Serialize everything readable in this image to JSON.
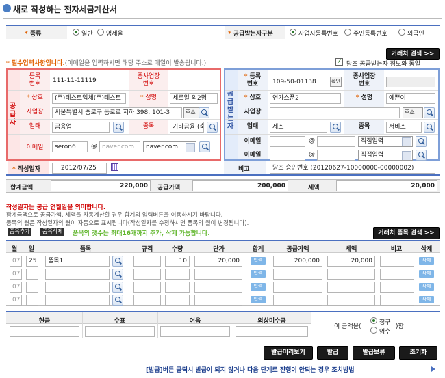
{
  "page": {
    "title": "새로 작성하는 전자세금계산서"
  },
  "type_row": {
    "kind_label": "종류",
    "kind_options": [
      "일반",
      "영세율"
    ],
    "kind_selected": 0,
    "recv_label": "공급받는자구분",
    "recv_options": [
      "사업자등록번호",
      "주민등록번호",
      "외국인"
    ],
    "recv_selected": 0
  },
  "buttons": {
    "partner_search": "거래처 검색 >>",
    "item_search": "거래처 품목 검색 >>",
    "add_item": "품목추가",
    "del_item": "품목삭제",
    "preview": "발급미리보기",
    "issue": "발급",
    "hold": "발급보류",
    "reset": "초기화",
    "confirm": "확인",
    "address": "주소",
    "input": "입력",
    "delete": "삭제"
  },
  "required_note": {
    "title": "* 필수입력사항입니다.",
    "text": "(이메일을 입력하시면 해당 주소로 메일이 발송됩니다.)"
  },
  "same_check": {
    "label": "당초 공급받는자 정보와 동일",
    "checked": true
  },
  "supplier": {
    "side_label": "공급자",
    "reg_label": "등록\n번호",
    "reg_value": "111-11-11119",
    "branch_label": "종사업장\n번호",
    "branch_value": "",
    "name_label": "상호",
    "name_value": "(주)테스트업체(주)테스트",
    "rep_label": "성명",
    "rep_value": "세로일 외2명",
    "addr_label": "사업장",
    "addr_value": "서울특별시 중로구 동로로 지하 398, 101-3",
    "biz_label": "업태",
    "biz_value": "금융업",
    "item_label": "종목",
    "item_value": "기타금융 (축협)",
    "email_label": "이메일",
    "email_id": "seron6",
    "email_domain_placeholder": "naver.com",
    "email_domain_select": "naver.com"
  },
  "buyer": {
    "side_label": "공급받는자",
    "reg_label": "등록\n번호",
    "reg_value": "109-50-01138",
    "branch_label": "종사업장\n번호",
    "branch_value": "",
    "name_label": "상호",
    "name_value": "연가스푼2",
    "rep_label": "성명",
    "rep_value": "예쁜이",
    "addr_label": "사업장",
    "addr_value": "",
    "biz_label": "업태",
    "biz_value": "제조",
    "item_label": "종목",
    "item_value": "서비스",
    "email_label": "이메일",
    "email_select": "직접입력"
  },
  "write_date": {
    "label": "작성일자",
    "value": "2012/07/25"
  },
  "remark": {
    "label": "비고",
    "value": "당초 승인번호 (20120627-10000000-00000002)"
  },
  "totals": {
    "sum_label": "합계금액",
    "sum_value": "220,000",
    "supply_label": "공급가액",
    "supply_value": "200,000",
    "tax_label": "세액",
    "tax_value": "20,000"
  },
  "notices": {
    "date_notice": "작성일자는 공급 연월일을 의미합니다.",
    "line1": "합계금액으로 공급가액, 세액을 자동계산할 경우 합계의 입력버튼을 이용하시기 바랍니다.",
    "line2": "품목의 월은 작성일자의 월이 자동으로 표시됩니다(작성일자를 수정하시면 품목의 월이 변경됩니다).",
    "item_limit": "품목의 갯수는 최대16개까지 추가, 삭제 가능합니다."
  },
  "item_table": {
    "headers": [
      "월",
      "일",
      "품목",
      "규격",
      "수량",
      "단가",
      "합계",
      "공급가액",
      "세액",
      "비고",
      "삭제"
    ],
    "rows": [
      {
        "month": "07",
        "day": "25",
        "name": "품목1",
        "spec": "",
        "qty": "10",
        "price": "20,000",
        "supply": "200,000",
        "tax": "20,000",
        "note": ""
      },
      {
        "month": "07",
        "day": "",
        "name": "",
        "spec": "",
        "qty": "",
        "price": "",
        "supply": "",
        "tax": "",
        "note": ""
      },
      {
        "month": "07",
        "day": "",
        "name": "",
        "spec": "",
        "qty": "",
        "price": "",
        "supply": "",
        "tax": "",
        "note": ""
      },
      {
        "month": "07",
        "day": "",
        "name": "",
        "spec": "",
        "qty": "",
        "price": "",
        "supply": "",
        "tax": "",
        "note": ""
      }
    ]
  },
  "payment": {
    "headers": [
      "현금",
      "수표",
      "어음",
      "외상미수금"
    ],
    "amount_prefix": "이 금액을(",
    "amount_suffix": ")함",
    "options": [
      "청구",
      "영수"
    ],
    "selected": 0
  },
  "footer": {
    "note": "[발급]버튼 클릭시 발급이 되지 않거나 다음 단계로 진행이 안되는 경우 조치방법"
  },
  "colors": {
    "red": "#d00000",
    "orange": "#e06000",
    "border_red": "#e86a6a",
    "border_blue": "#7e9fd8",
    "green": "#5fb52a"
  }
}
